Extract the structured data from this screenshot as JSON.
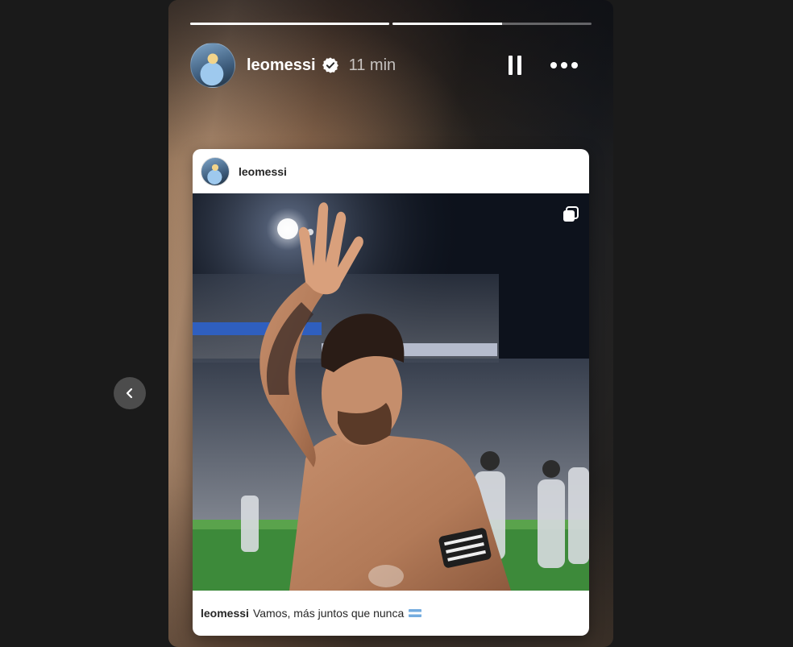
{
  "story": {
    "progress": [
      1.0,
      0.55
    ],
    "username": "leomessi",
    "time": "11 min"
  },
  "post": {
    "username": "leomessi",
    "caption_user": "leomessi",
    "caption_text": "Vamos, más juntos que nunca"
  },
  "icons": {
    "verified": "verified-badge-icon",
    "pause": "pause-icon",
    "more": "more-options-icon",
    "carousel": "carousel-icon",
    "prev": "chevron-left-icon",
    "flag": "argentina-flag-emoji"
  },
  "colors": {
    "page_bg": "#1a1a1a",
    "card_bg": "#ffffff",
    "text_dark": "#262626"
  }
}
